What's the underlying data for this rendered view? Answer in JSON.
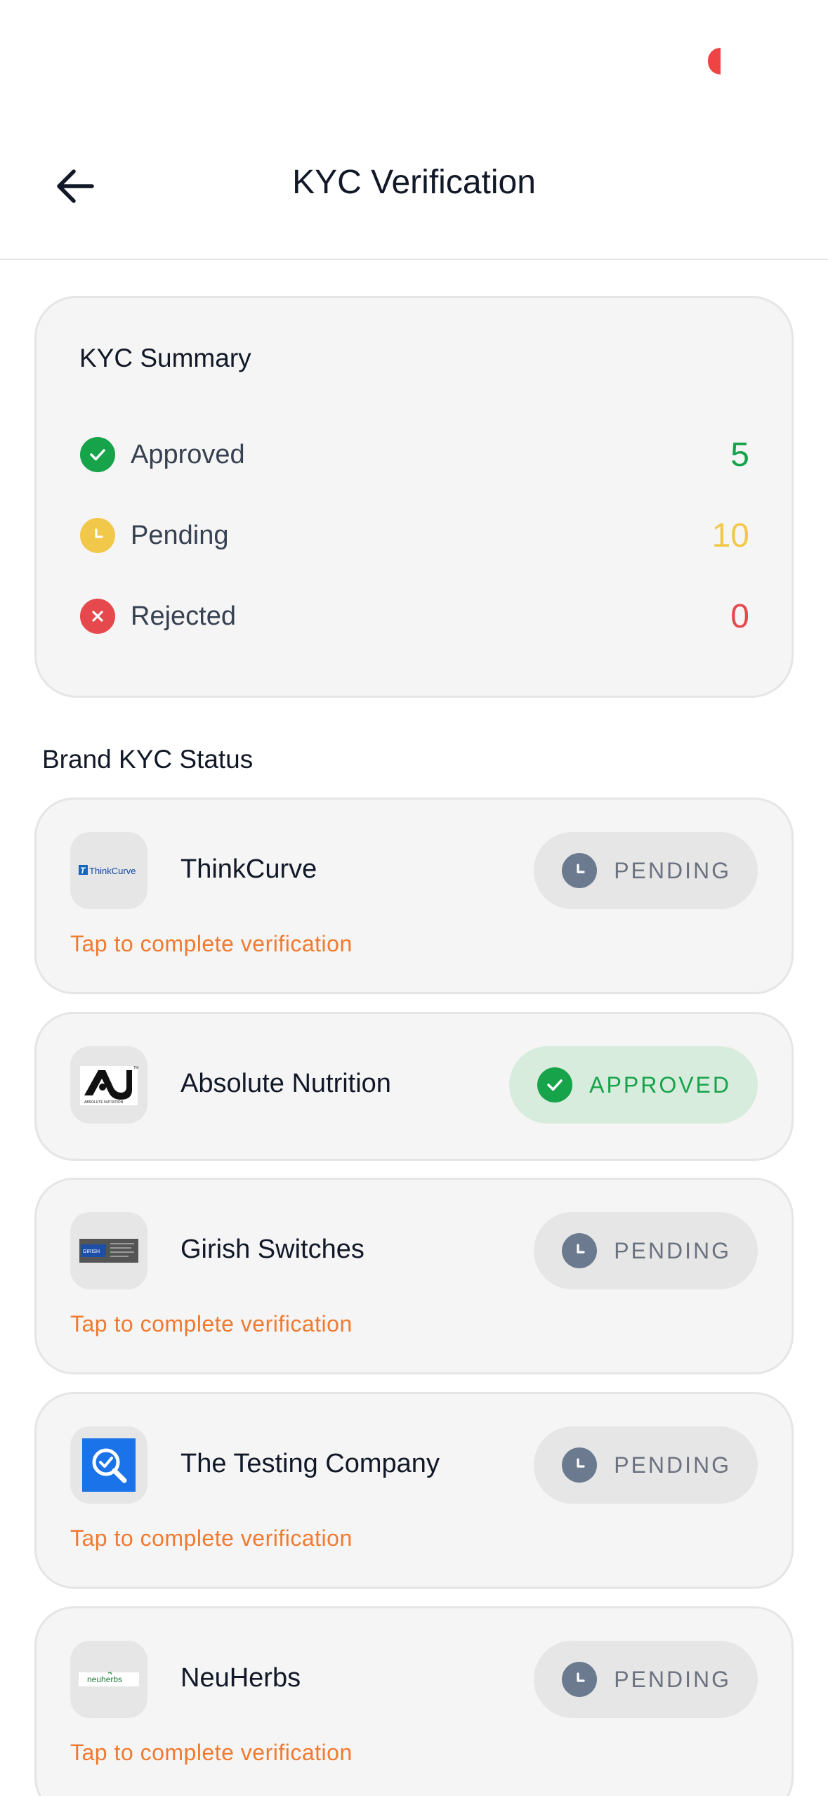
{
  "header": {
    "title": "KYC Verification"
  },
  "summary": {
    "title": "KYC Summary",
    "rows": [
      {
        "label": "Approved",
        "value": "5",
        "color": "#16a34a",
        "icon": "check-circle-icon"
      },
      {
        "label": "Pending",
        "value": "10",
        "color": "#f2c84b",
        "icon": "clock-icon"
      },
      {
        "label": "Rejected",
        "value": "0",
        "color": "#e5484d",
        "icon": "x-circle-icon"
      }
    ]
  },
  "brands": {
    "section_title": "Brand KYC Status",
    "tap_label": "Tap to complete verification",
    "items": [
      {
        "name": "ThinkCurve",
        "status": "PENDING",
        "logo_text": "ThinkCurve"
      },
      {
        "name": "Absolute Nutrition",
        "status": "APPROVED",
        "logo_text": "ABSOLUTE NUTRITION"
      },
      {
        "name": "Girish Switches",
        "status": "PENDING",
        "logo_text": "GIRISH"
      },
      {
        "name": "The Testing Company",
        "status": "PENDING",
        "logo_text": ""
      },
      {
        "name": "NeuHerbs",
        "status": "PENDING",
        "logo_text": "neuherbs"
      }
    ]
  },
  "colors": {
    "accent_orange": "#f07a30",
    "approved_green": "#16a34a",
    "pending_gray": "#6b7280"
  }
}
